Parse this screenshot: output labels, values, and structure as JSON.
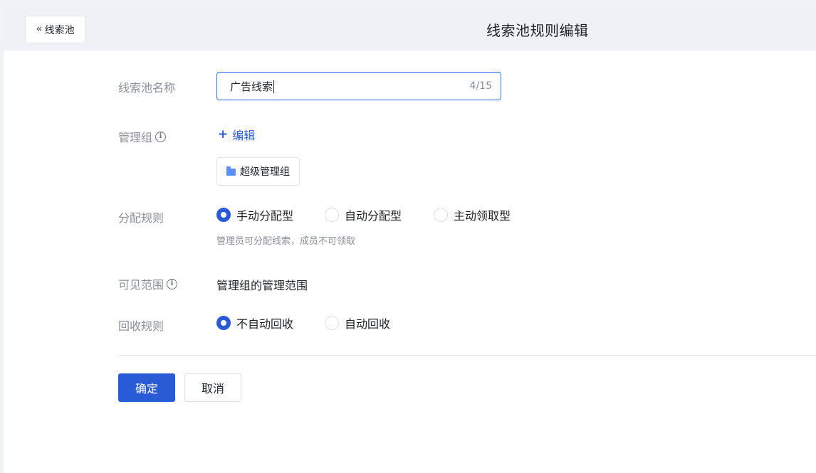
{
  "header": {
    "back_label": "线索池",
    "title": "线索池规则编辑"
  },
  "form": {
    "name": {
      "label": "线索池名称",
      "value": "广告线索",
      "counter": "4/15"
    },
    "admin_group": {
      "label": "管理组",
      "edit_label": "编辑",
      "tag": "超级管理组"
    },
    "assign_rule": {
      "label": "分配规则",
      "options": [
        "手动分配型",
        "自动分配型",
        "主动领取型"
      ],
      "selected": "手动分配型",
      "hint": "管理员可分配线索，成员不可领取"
    },
    "visible_scope": {
      "label": "可见范围",
      "value": "管理组的管理范围"
    },
    "recycle_rule": {
      "label": "回收规则",
      "options": [
        "不自动回收",
        "自动回收"
      ],
      "selected": "不自动回收"
    }
  },
  "actions": {
    "confirm": "确定",
    "cancel": "取消"
  },
  "colors": {
    "primary": "#2a5bd7",
    "header_bg": "#eff1f7",
    "label_gray": "#8a8f99"
  }
}
